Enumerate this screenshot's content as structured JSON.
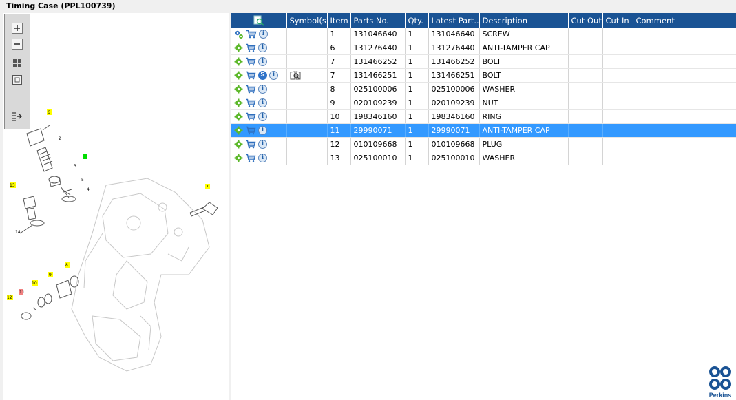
{
  "window": {
    "title": "Timing Case (PPL100739)"
  },
  "zoom_toolbar": {
    "buttons": [
      {
        "name": "zoom-in-button",
        "icon": "zoom-in-icon"
      },
      {
        "name": "zoom-out-button",
        "icon": "zoom-out-icon"
      },
      {
        "name": "fit-all-button",
        "icon": "fit-all-icon"
      },
      {
        "name": "actual-size-button",
        "icon": "actual-size-icon"
      },
      {
        "name": "toggle-panel-button",
        "icon": "toggle-panel-icon"
      }
    ]
  },
  "diagram": {
    "callouts": [
      "6",
      "2",
      "3",
      "5",
      "4",
      "13",
      "14",
      "7",
      "8",
      "9",
      "10",
      "11",
      "12"
    ],
    "highlight_colors": {
      "yellow": "#ffff00",
      "green": "#00dd00",
      "red": "#f08080"
    }
  },
  "table": {
    "columns": {
      "icons": "",
      "symbols": "Symbol(s)",
      "item": "Item",
      "parts_no": "Parts No.",
      "qty": "Qty.",
      "latest_part": "Latest Part...",
      "description": "Description",
      "cut_out": "Cut Out",
      "cut_in": "Cut In",
      "comment": "Comment"
    },
    "header_icon": "find-icon",
    "rows": [
      {
        "item": "1",
        "parts_no": "131046640",
        "qty": "1",
        "latest_part": "131046640",
        "description": "SCREW",
        "first_icon": "assembly-gears-icon",
        "s_badge": false,
        "symbol": false,
        "selected": false
      },
      {
        "item": "6",
        "parts_no": "131276440",
        "qty": "1",
        "latest_part": "131276440",
        "description": "ANTI-TAMPER CAP",
        "first_icon": "gear-icon",
        "s_badge": false,
        "symbol": false,
        "selected": false
      },
      {
        "item": "7",
        "parts_no": "131466252",
        "qty": "1",
        "latest_part": "131466252",
        "description": "BOLT",
        "first_icon": "gear-icon",
        "s_badge": false,
        "symbol": false,
        "selected": false
      },
      {
        "item": "7",
        "parts_no": "131466251",
        "qty": "1",
        "latest_part": "131466251",
        "description": "BOLT",
        "first_icon": "gear-icon",
        "s_badge": true,
        "symbol": true,
        "selected": false
      },
      {
        "item": "8",
        "parts_no": "025100006",
        "qty": "1",
        "latest_part": "025100006",
        "description": "WASHER",
        "first_icon": "gear-icon",
        "s_badge": false,
        "symbol": false,
        "selected": false
      },
      {
        "item": "9",
        "parts_no": "020109239",
        "qty": "1",
        "latest_part": "020109239",
        "description": "NUT",
        "first_icon": "gear-icon",
        "s_badge": false,
        "symbol": false,
        "selected": false
      },
      {
        "item": "10",
        "parts_no": "198346160",
        "qty": "1",
        "latest_part": "198346160",
        "description": "RING",
        "first_icon": "gear-icon",
        "s_badge": false,
        "symbol": false,
        "selected": false
      },
      {
        "item": "11",
        "parts_no": "29990071",
        "qty": "1",
        "latest_part": "29990071",
        "description": "ANTI-TAMPER CAP",
        "first_icon": "gear-icon",
        "s_badge": false,
        "symbol": false,
        "selected": true
      },
      {
        "item": "12",
        "parts_no": "010109668",
        "qty": "1",
        "latest_part": "010109668",
        "description": "PLUG",
        "first_icon": "gear-icon",
        "s_badge": false,
        "symbol": false,
        "selected": false
      },
      {
        "item": "13",
        "parts_no": "025100010",
        "qty": "1",
        "latest_part": "025100010",
        "description": "WASHER",
        "first_icon": "gear-icon",
        "s_badge": false,
        "symbol": false,
        "selected": false
      }
    ]
  },
  "brand": {
    "name": "Perkins",
    "color": "#1a5394"
  },
  "colors": {
    "header_bg": "#1a5394",
    "selected_row": "#3399ff",
    "gear_green": "#5cb82a"
  }
}
